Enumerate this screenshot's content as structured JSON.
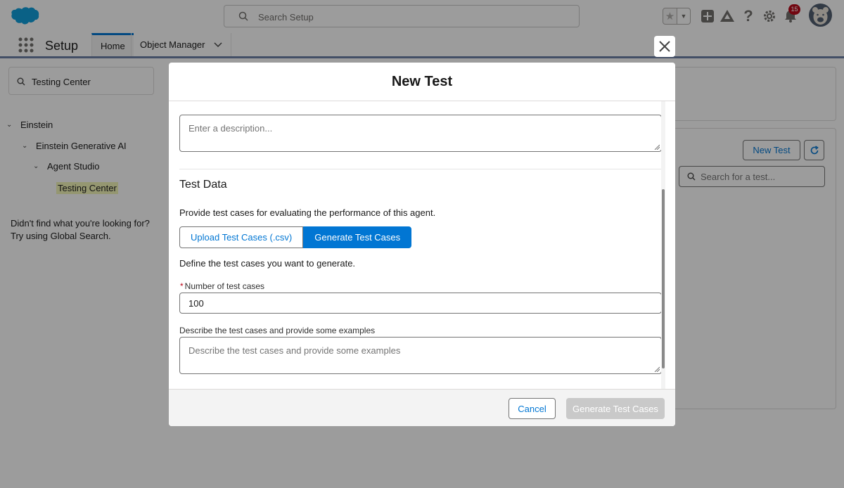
{
  "header": {
    "search_placeholder": "Search Setup",
    "notification_count": "15",
    "icons": [
      "salesforce-logo",
      "star-icon",
      "chevron-down-icon",
      "plus-icon",
      "trailhead-icon",
      "help-icon",
      "gear-icon",
      "bell-icon",
      "avatar"
    ]
  },
  "context_nav": {
    "app_name": "Setup",
    "tabs": [
      {
        "label": "Home",
        "active": true
      },
      {
        "label": "Object Manager",
        "active": false
      }
    ]
  },
  "sidebar": {
    "quickfind_value": "Testing Center",
    "tree": [
      {
        "label": "Einstein",
        "level": 0,
        "expanded": true
      },
      {
        "label": "Einstein Generative AI",
        "level": 1,
        "expanded": true
      },
      {
        "label": "Agent Studio",
        "level": 2,
        "expanded": true
      },
      {
        "label": "Testing Center",
        "level": 3,
        "highlighted": true
      }
    ],
    "help_line1": "Didn't find what you're looking for?",
    "help_line2": "Try using Global Search."
  },
  "background_panel": {
    "new_test_label": "New Test",
    "search_placeholder": "Search for a test..."
  },
  "modal": {
    "title": "New Test",
    "description_placeholder": "Enter a description...",
    "test_data": {
      "section_title": "Test Data",
      "intro": "Provide test cases for evaluating the performance of this agent.",
      "options": [
        {
          "label": "Upload Test Cases (.csv)",
          "selected": false
        },
        {
          "label": "Generate Test Cases",
          "selected": true
        }
      ],
      "define_text": "Define the test cases you want to generate.",
      "number_label": "Number of test cases",
      "number_required": true,
      "number_value": "100",
      "describe_label": "Describe the test cases and provide some examples",
      "describe_placeholder": "Describe the test cases and provide some examples"
    },
    "footer": {
      "cancel_label": "Cancel",
      "generate_label": "Generate Test Cases",
      "generate_disabled": true
    }
  },
  "colors": {
    "brand_blue": "#0176d3",
    "required_red": "#ba0517",
    "disabled_gray": "#c9c9c9",
    "highlight_yellow": "#f4f7b8"
  }
}
